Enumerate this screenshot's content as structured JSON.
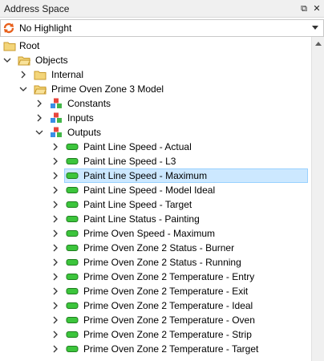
{
  "panel": {
    "title": "Address Space",
    "float_glyph": "⧉",
    "close_glyph": "✕"
  },
  "highlight_select": {
    "value": "No Highlight"
  },
  "tree": {
    "root": "Root",
    "objects": "Objects",
    "internal": "Internal",
    "model": "Prime Oven Zone 3 Model",
    "constants": "Constants",
    "inputs": "Inputs",
    "outputs": "Outputs",
    "output_items": [
      "Paint Line Speed - Actual",
      "Paint Line Speed - L3",
      "Paint Line Speed - Maximum",
      "Paint Line Speed - Model Ideal",
      "Paint Line Speed - Target",
      "Paint Line Status - Painting",
      "Prime Oven Speed - Maximum",
      "Prime Oven Zone 2 Status - Burner",
      "Prime Oven Zone 2 Status - Running",
      "Prime Oven Zone 2 Temperature - Entry",
      "Prime Oven Zone 2 Temperature - Exit",
      "Prime Oven Zone 2 Temperature - Ideal",
      "Prime Oven Zone 2 Temperature - Oven",
      "Prime Oven Zone 2 Temperature - Strip",
      "Prime Oven Zone 2 Temperature - Target"
    ],
    "selected_item": "Paint Line Speed - Maximum"
  },
  "colors": {
    "folder": "#e8c25a",
    "variable": "#3cc53c",
    "selection": "#cce8ff"
  },
  "icons": {
    "refresh": "refresh-icon",
    "folder": "folder-icon",
    "object": "object-cubes-icon",
    "variable": "variable-icon"
  }
}
